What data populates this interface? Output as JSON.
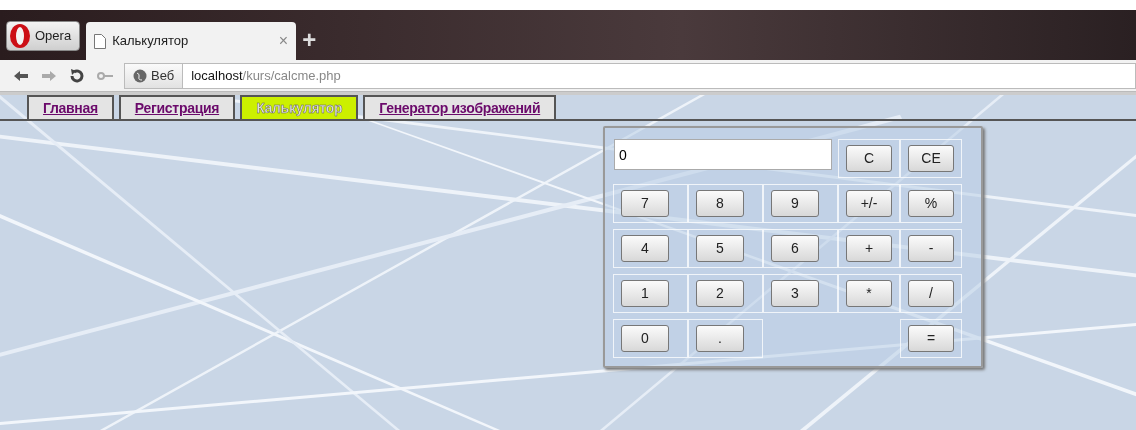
{
  "browser": {
    "menu_button": "Opera",
    "tabs": [
      {
        "title": "Калькулятор",
        "selected": true
      }
    ],
    "close_mark": "×",
    "new_tab": "+",
    "address": {
      "badge": "Веб",
      "host": "localhost",
      "path": "/kurs/calcme.php"
    }
  },
  "nav": [
    {
      "label": "Главная",
      "selected": false
    },
    {
      "label": "Регистрация",
      "selected": false
    },
    {
      "label": "Калькулятор",
      "selected": true
    },
    {
      "label": "Генератор изображений",
      "selected": false
    }
  ],
  "calculator": {
    "display": "0",
    "top_keys": [
      "C",
      "CE"
    ],
    "rows": [
      {
        "digits": [
          "7",
          "8",
          "9"
        ],
        "ops": [
          "+/-",
          "%"
        ]
      },
      {
        "digits": [
          "4",
          "5",
          "6"
        ],
        "ops": [
          "+",
          "-"
        ]
      },
      {
        "digits": [
          "1",
          "2",
          "3"
        ],
        "ops": [
          "*",
          "/"
        ]
      },
      {
        "digits": [
          "0",
          "."
        ],
        "ops": [
          "="
        ]
      }
    ]
  }
}
